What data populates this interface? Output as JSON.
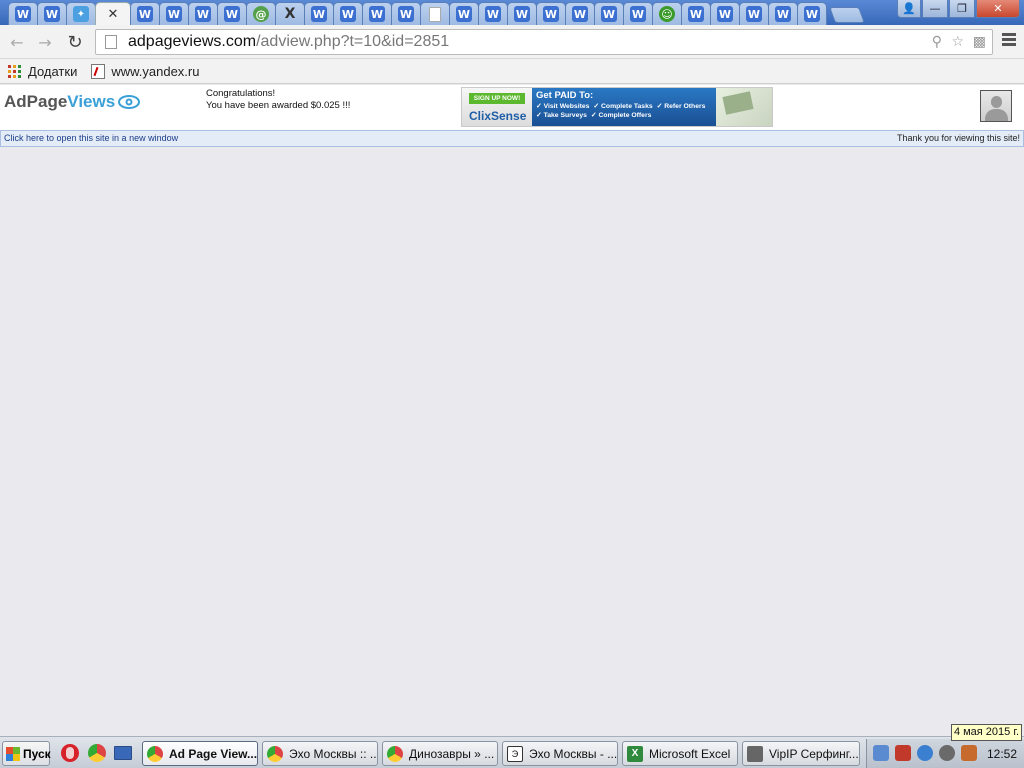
{
  "browser": {
    "tabs": [
      {
        "icon": "w-icon",
        "glyph": "W"
      },
      {
        "icon": "w-icon",
        "glyph": "W"
      },
      {
        "icon": "bird-icon",
        "glyph": "✦"
      },
      {
        "icon": "close-icon",
        "glyph": "✕",
        "active": true
      },
      {
        "icon": "w-icon",
        "glyph": "W"
      },
      {
        "icon": "w-icon",
        "glyph": "W"
      },
      {
        "icon": "w-icon",
        "glyph": "W"
      },
      {
        "icon": "w-icon",
        "glyph": "W"
      },
      {
        "icon": "mail-icon",
        "glyph": "@"
      },
      {
        "icon": "x-icon",
        "glyph": "X"
      },
      {
        "icon": "w-icon",
        "glyph": "W"
      },
      {
        "icon": "w-icon",
        "glyph": "W"
      },
      {
        "icon": "w-icon",
        "glyph": "W"
      },
      {
        "icon": "w-icon",
        "glyph": "W"
      },
      {
        "icon": "doc-icon",
        "glyph": ""
      },
      {
        "icon": "w-icon",
        "glyph": "W"
      },
      {
        "icon": "w-icon",
        "glyph": "W"
      },
      {
        "icon": "w-icon",
        "glyph": "W"
      },
      {
        "icon": "w-icon",
        "glyph": "W"
      },
      {
        "icon": "w-icon",
        "glyph": "W"
      },
      {
        "icon": "w-icon",
        "glyph": "W"
      },
      {
        "icon": "w-icon",
        "glyph": "W"
      },
      {
        "icon": "frog-icon",
        "glyph": "☺"
      },
      {
        "icon": "w-icon",
        "glyph": "W"
      },
      {
        "icon": "w-icon",
        "glyph": "W"
      },
      {
        "icon": "w-icon",
        "glyph": "W"
      },
      {
        "icon": "w-icon",
        "glyph": "W"
      },
      {
        "icon": "w-icon",
        "glyph": "W"
      }
    ],
    "window_controls": {
      "minimize": "—",
      "restore": "❐",
      "close": "✕",
      "user": "👤"
    },
    "url_host": "adpageviews.com",
    "url_path": "/adview.php?t=10&id=2851",
    "bookmarks": {
      "apps_label": "Додатки",
      "yandex_label": "www.yandex.ru"
    }
  },
  "page": {
    "logo_ad": "AdPage",
    "logo_views": "Views",
    "congrats_line1": "Congratulations!",
    "congrats_line2": "You have been awarded $0.025 !!!",
    "banner": {
      "signup": "SIGN UP NOW!",
      "brand": "ClixSense",
      "title": "Get PAID To:",
      "row1": [
        "✓ Visit Websites",
        "✓ Complete Tasks",
        "✓ Refer Others"
      ],
      "row2": [
        "✓ Take Surveys",
        "✓ Complete Offers"
      ]
    },
    "open_link": "Click here to open this site in a new window",
    "thanks": "Thank you for viewing this site!"
  },
  "taskbar": {
    "start_label": "Пуск",
    "tasks": [
      {
        "label": "Ad Page View...",
        "icon": "chrome",
        "active": true
      },
      {
        "label": "Эхо Москвы :: ...",
        "icon": "chrome"
      },
      {
        "label": "Динозавры » ...",
        "icon": "chrome"
      },
      {
        "label": "Эхо Москвы - ...",
        "icon": "echo"
      },
      {
        "label": "Microsoft Excel",
        "icon": "excel"
      },
      {
        "label": "VipIP Серфинг...",
        "icon": "vip"
      }
    ],
    "clock": "12:52",
    "date_tooltip": "4 мая 2015 г."
  }
}
